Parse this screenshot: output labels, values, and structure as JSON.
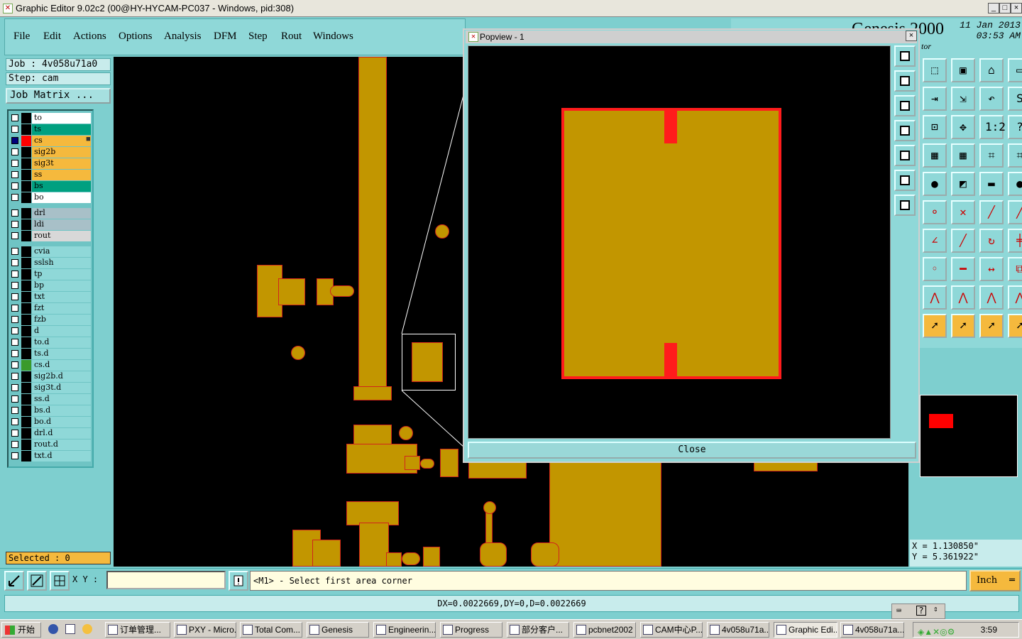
{
  "window": {
    "title": "Graphic Editor 9.02c2 (00@HY-HYCAM-PC037 - Windows, pid:308)",
    "controls": [
      "_",
      "□",
      "×"
    ]
  },
  "menu": [
    "File",
    "Edit",
    "Actions",
    "Options",
    "Analysis",
    "DFM",
    "Step",
    "Rout",
    "Windows"
  ],
  "brand": {
    "product": "Genesis 2000",
    "date": "11 Jan 2013",
    "time": "03:53 AM",
    "subtitle": "tor"
  },
  "job": {
    "job_label": "Job  : 4v058u71a0",
    "step_label": "Step: cam",
    "job_matrix": "Job Matrix ..."
  },
  "layers": [
    {
      "name": "to",
      "color": "#ffffff",
      "indicator": "#000000",
      "checked": false
    },
    {
      "name": "ts",
      "color": "#00a080",
      "indicator": "#000000",
      "checked": false
    },
    {
      "name": "cs",
      "color": "#f5b93d",
      "indicator": "#ff0000",
      "checked": true,
      "mark": "■"
    },
    {
      "name": "sig2b",
      "color": "#f5b93d",
      "indicator": "#000000",
      "checked": false
    },
    {
      "name": "sig3t",
      "color": "#f5b93d",
      "indicator": "#000000",
      "checked": false
    },
    {
      "name": "ss",
      "color": "#f5b93d",
      "indicator": "#000000",
      "checked": false
    },
    {
      "name": "bs",
      "color": "#00a080",
      "indicator": "#000000",
      "checked": false
    },
    {
      "name": "bo",
      "color": "#ffffff",
      "indicator": "#000000",
      "checked": false
    },
    {
      "name": "drl",
      "color": "#a8c0c8",
      "indicator": "#000000",
      "checked": false
    },
    {
      "name": "ldi",
      "color": "#a8c0c8",
      "indicator": "#000000",
      "checked": false
    },
    {
      "name": "rout",
      "color": "#d8d8d8",
      "indicator": "#000000",
      "checked": false
    },
    {
      "name": "cvia",
      "color": "#8fd8d8",
      "indicator": "#000000",
      "checked": false
    },
    {
      "name": "sslsh",
      "color": "#8fd8d8",
      "indicator": "#000000",
      "checked": false
    },
    {
      "name": "tp",
      "color": "#8fd8d8",
      "indicator": "#000000",
      "checked": false
    },
    {
      "name": "bp",
      "color": "#8fd8d8",
      "indicator": "#000000",
      "checked": false
    },
    {
      "name": "txt",
      "color": "#8fd8d8",
      "indicator": "#000000",
      "checked": false
    },
    {
      "name": "fzt",
      "color": "#8fd8d8",
      "indicator": "#000000",
      "checked": false
    },
    {
      "name": "fzb",
      "color": "#8fd8d8",
      "indicator": "#000000",
      "checked": false
    },
    {
      "name": "d",
      "color": "#8fd8d8",
      "indicator": "#000000",
      "checked": false
    },
    {
      "name": "to.d",
      "color": "#8fd8d8",
      "indicator": "#000000",
      "checked": false
    },
    {
      "name": "ts.d",
      "color": "#8fd8d8",
      "indicator": "#000000",
      "checked": false
    },
    {
      "name": "cs.d",
      "color": "#8fd8d8",
      "indicator": "#3a9a2a",
      "checked": false
    },
    {
      "name": "sig2b.d",
      "color": "#8fd8d8",
      "indicator": "#000000",
      "checked": false
    },
    {
      "name": "sig3t.d",
      "color": "#8fd8d8",
      "indicator": "#000000",
      "checked": false
    },
    {
      "name": "ss.d",
      "color": "#8fd8d8",
      "indicator": "#000000",
      "checked": false
    },
    {
      "name": "bs.d",
      "color": "#8fd8d8",
      "indicator": "#000000",
      "checked": false
    },
    {
      "name": "bo.d",
      "color": "#8fd8d8",
      "indicator": "#000000",
      "checked": false
    },
    {
      "name": "drl.d",
      "color": "#8fd8d8",
      "indicator": "#000000",
      "checked": false
    },
    {
      "name": "rout.d",
      "color": "#8fd8d8",
      "indicator": "#000000",
      "checked": false
    },
    {
      "name": "txt.d",
      "color": "#8fd8d8",
      "indicator": "#000000",
      "checked": false
    }
  ],
  "selected": "Selected : 0",
  "popview": {
    "title": "Popview - 1",
    "close_label": "Close",
    "tools": [
      "zoom-home-icon",
      "zoom-in-icon",
      "zoom-out-icon",
      "pan-left-icon",
      "pan-right-icon",
      "fit-icon",
      "center-icon"
    ]
  },
  "toolbox_icons": [
    "zoom-area-icon",
    "print-icon",
    "home-icon",
    "frame-icon",
    "move-icon",
    "step-icon",
    "undo-icon",
    "snap-icon",
    "fit-all-icon",
    "center-icon",
    "scale-icon",
    "help-icon",
    "grid-icon",
    "grid-icon",
    "measure-icon",
    "measure-icon",
    "pad-icon",
    "clip-icon",
    "ruler-icon",
    "dot-icon",
    "connect-icon",
    "delete-icon",
    "line-icon",
    "line-icon",
    "angle-icon",
    "slash-icon",
    "rotate-icon",
    "split-icon",
    "mark-icon",
    "minus-icon",
    "distance-icon",
    "copy-icon",
    "arc-icon",
    "arc-icon",
    "arc-icon",
    "arc-icon",
    "select-icon",
    "select-icon",
    "select-icon",
    "select-icon"
  ],
  "coords": {
    "x": "X  =  1.130850\"",
    "y": "Y  =  5.361922\""
  },
  "statusbar": {
    "xy_label": "X Y :",
    "xy_value": "",
    "message": "<M1> - Select first area corner",
    "unit": "Inch"
  },
  "dx_readout": "DX=0.0022669,DY=0,D=0.0022669",
  "taskbar": {
    "start": "开始",
    "tasks": [
      "订单管理...",
      "PXY - Micro...",
      "Total Com...",
      "Genesis",
      "Engineerin...",
      "Progress",
      "部分客户...",
      "pcbnet2002",
      "CAM中心P...",
      "4v058u71a...",
      "Graphic Edi...",
      "4v058u71a..."
    ],
    "active_index": 10,
    "clock": "3:59"
  },
  "colors": {
    "copper": "#c29600",
    "outline": "#d0241c",
    "panel": "#8fd8d8",
    "highlight": "#f5b93d"
  }
}
